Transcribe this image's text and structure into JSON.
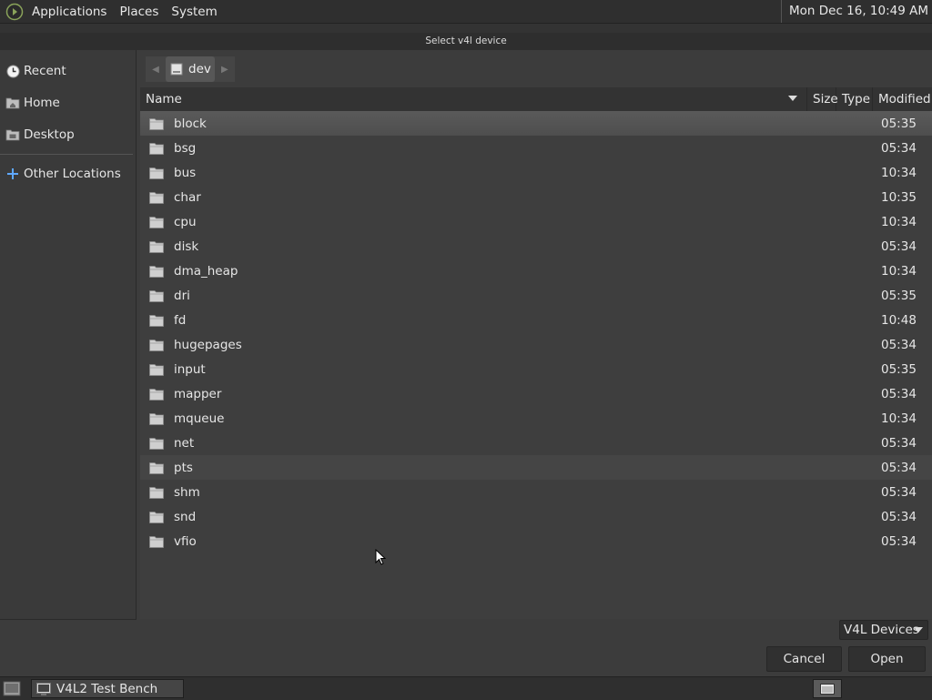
{
  "top_panel": {
    "menus": [
      "Applications",
      "Places",
      "System"
    ],
    "clock": "Mon Dec 16, 10:49 AM"
  },
  "dialog": {
    "title": "Select v4l device",
    "sidebar": {
      "items": [
        {
          "label": "Recent",
          "icon": "clock-icon"
        },
        {
          "label": "Home",
          "icon": "home-folder-icon"
        },
        {
          "label": "Desktop",
          "icon": "desktop-folder-icon"
        },
        {
          "label": "Other Locations",
          "icon": "plus-icon"
        }
      ]
    },
    "path": {
      "current": "dev",
      "drive_icon": "drive-icon"
    },
    "columns": {
      "name": "Name",
      "size": "Size",
      "type": "Type",
      "modified": "Modified"
    },
    "rows": [
      {
        "name": "block",
        "modified": "05:35"
      },
      {
        "name": "bsg",
        "modified": "05:34"
      },
      {
        "name": "bus",
        "modified": "10:34"
      },
      {
        "name": "char",
        "modified": "10:35"
      },
      {
        "name": "cpu",
        "modified": "10:34"
      },
      {
        "name": "disk",
        "modified": "05:34"
      },
      {
        "name": "dma_heap",
        "modified": "10:34"
      },
      {
        "name": "dri",
        "modified": "05:35"
      },
      {
        "name": "fd",
        "modified": "10:48"
      },
      {
        "name": "hugepages",
        "modified": "05:34"
      },
      {
        "name": "input",
        "modified": "05:35"
      },
      {
        "name": "mapper",
        "modified": "05:34"
      },
      {
        "name": "mqueue",
        "modified": "10:34"
      },
      {
        "name": "net",
        "modified": "05:34"
      },
      {
        "name": "pts",
        "modified": "05:34"
      },
      {
        "name": "shm",
        "modified": "05:34"
      },
      {
        "name": "snd",
        "modified": "05:34"
      },
      {
        "name": "vfio",
        "modified": "05:34"
      }
    ],
    "selected_row": "block",
    "hovered_row": "pts",
    "filter": "V4L Devices",
    "buttons": {
      "cancel": "Cancel",
      "open": "Open"
    }
  },
  "taskbar": {
    "task_label": "V4L2 Test Bench"
  },
  "colors": {
    "panel": "#2f2f2f",
    "dialog_bg": "#3c3c3c",
    "folder": "#cfcfcf"
  }
}
